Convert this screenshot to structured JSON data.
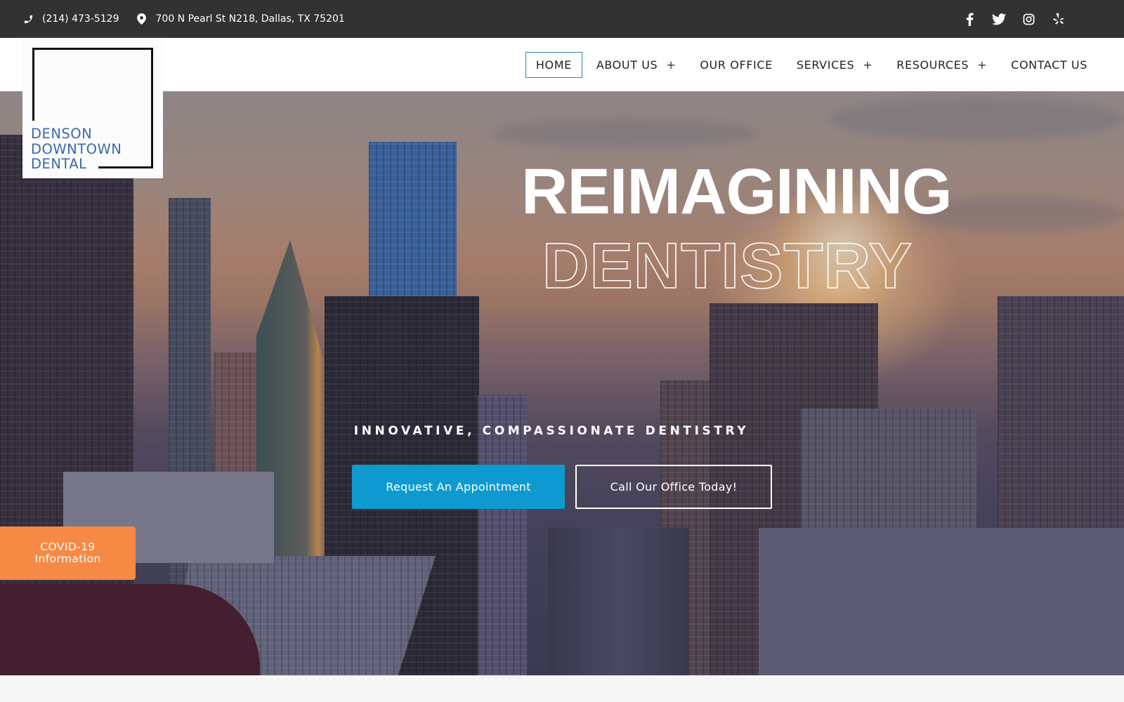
{
  "topbar": {
    "phone": "(214) 473-5129",
    "address": "700 N Pearl St N218, Dallas, TX 75201",
    "phone_icon": "phone-icon",
    "address_icon": "map-marker-icon",
    "social": [
      {
        "name": "facebook",
        "icon": "facebook-icon"
      },
      {
        "name": "twitter",
        "icon": "twitter-icon"
      },
      {
        "name": "instagram",
        "icon": "instagram-icon"
      },
      {
        "name": "yelp",
        "icon": "yelp-icon"
      }
    ]
  },
  "logo": {
    "line1": "DENSON",
    "line2": "DOWNTOWN",
    "line3": "DENTAL"
  },
  "nav": {
    "items": [
      {
        "label": "HOME",
        "active": true,
        "has_submenu": false
      },
      {
        "label": "ABOUT US",
        "active": false,
        "has_submenu": true
      },
      {
        "label": "OUR OFFICE",
        "active": false,
        "has_submenu": false
      },
      {
        "label": "SERVICES",
        "active": false,
        "has_submenu": true
      },
      {
        "label": "RESOURCES",
        "active": false,
        "has_submenu": true
      },
      {
        "label": "CONTACT US",
        "active": false,
        "has_submenu": false
      }
    ],
    "submenu_indicator": "+"
  },
  "hero": {
    "headline_line1": "REIMAGINING",
    "headline_line2": "DENTISTRY",
    "tagline": "INNOVATIVE, COMPASSIONATE DENTISTRY",
    "primary_button": "Request An Appointment",
    "secondary_button": "Call Our Office Today!"
  },
  "covid_button": {
    "line1": "COVID-19",
    "line2": "Information"
  },
  "colors": {
    "topbar_bg": "#323232",
    "logo_text": "#3a68a8",
    "nav_active_border": "#2a86a8",
    "primary_button": "#0e9ad0",
    "covid_button": "#f68a45"
  }
}
